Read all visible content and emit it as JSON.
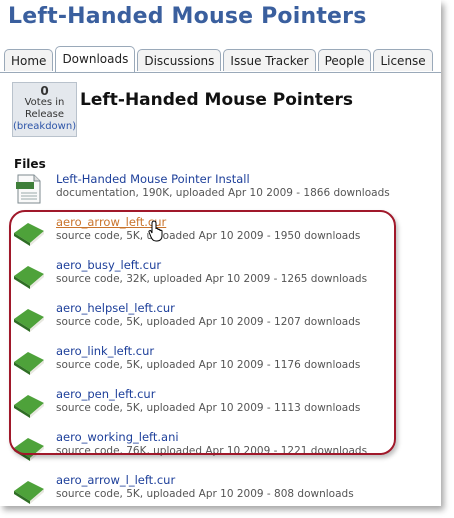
{
  "header": {
    "title": "Left-Handed Mouse Pointers"
  },
  "tabs": [
    {
      "label": "Home"
    },
    {
      "label": "Downloads"
    },
    {
      "label": "Discussions"
    },
    {
      "label": "Issue Tracker"
    },
    {
      "label": "People"
    },
    {
      "label": "License"
    }
  ],
  "vote": {
    "count": "0",
    "line1": "Votes in",
    "line2": "Release",
    "breakdown": "(breakdown)"
  },
  "project": {
    "name": "Left-Handed Mouse Pointers"
  },
  "files_label": "Files",
  "files": [
    {
      "name": "Left-Handed Mouse Pointer Install",
      "meta": "documentation, 190K, uploaded Apr 10 2009 - 1866 downloads",
      "icon": "document-icon"
    },
    {
      "name": "aero_arrow_left.cur",
      "meta": "source code, 5K, uploaded Apr 10 2009 - 1950 downloads",
      "icon": "book-icon"
    },
    {
      "name": "aero_busy_left.cur",
      "meta": "source code, 32K, uploaded Apr 10 2009 - 1265 downloads",
      "icon": "book-icon"
    },
    {
      "name": "aero_helpsel_left.cur",
      "meta": "source code, 5K, uploaded Apr 10 2009 - 1207 downloads",
      "icon": "book-icon"
    },
    {
      "name": "aero_link_left.cur",
      "meta": "source code, 5K, uploaded Apr 10 2009 - 1176 downloads",
      "icon": "book-icon"
    },
    {
      "name": "aero_pen_left.cur",
      "meta": "source code, 5K, uploaded Apr 10 2009 - 1113 downloads",
      "icon": "book-icon"
    },
    {
      "name": "aero_working_left.ani",
      "meta": "source code, 76K, uploaded Apr 10 2009 - 1221 downloads",
      "icon": "book-icon"
    },
    {
      "name": "aero_arrow_l_left.cur",
      "meta": "source code, 5K, uploaded Apr 10 2009 - 808 downloads",
      "icon": "book-icon"
    }
  ],
  "colors": {
    "title": "#3a5f9e",
    "link": "#1d3f9a",
    "hover_link": "#c9742c",
    "highlight": "#a0182a"
  }
}
